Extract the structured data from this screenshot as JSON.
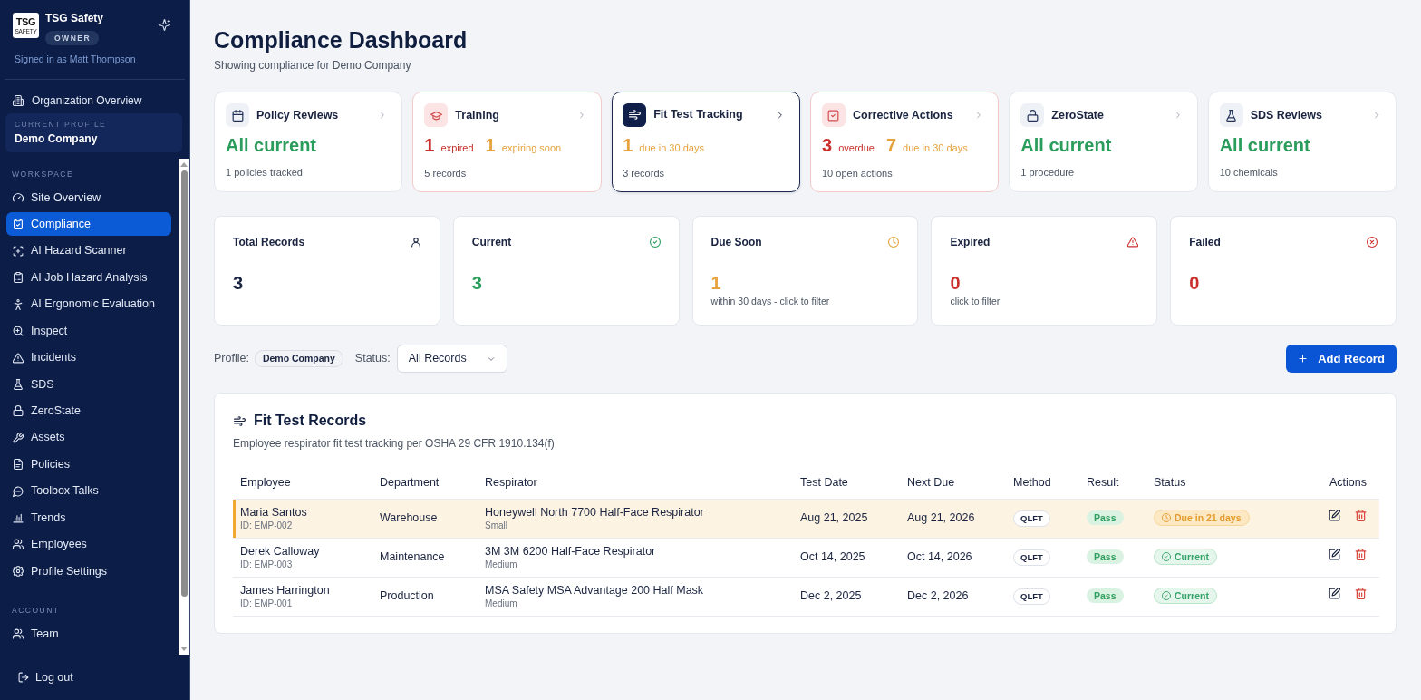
{
  "sidebar": {
    "brand": {
      "logo_text": "TSG",
      "logo_subtext": "SAFETY",
      "name": "TSG Safety",
      "role": "OWNER",
      "signed_in": "Signed in as Matt Thompson"
    },
    "overview_link": "Organization Overview",
    "current_profile": {
      "label": "CURRENT PROFILE",
      "name": "Demo Company"
    },
    "sections": [
      {
        "heading": "WORKSPACE",
        "items": [
          {
            "label": "Site Overview",
            "selected": false
          },
          {
            "label": "Compliance",
            "selected": true
          },
          {
            "label": "AI Hazard Scanner",
            "selected": false
          },
          {
            "label": "AI Job Hazard Analysis",
            "selected": false
          },
          {
            "label": "AI Ergonomic Evaluation",
            "selected": false
          },
          {
            "label": "Inspect",
            "selected": false
          },
          {
            "label": "Incidents",
            "selected": false
          },
          {
            "label": "SDS",
            "selected": false
          },
          {
            "label": "ZeroState",
            "selected": false
          },
          {
            "label": "Assets",
            "selected": false
          },
          {
            "label": "Policies",
            "selected": false
          },
          {
            "label": "Toolbox Talks",
            "selected": false
          },
          {
            "label": "Trends",
            "selected": false
          },
          {
            "label": "Employees",
            "selected": false
          },
          {
            "label": "Profile Settings",
            "selected": false
          }
        ]
      },
      {
        "heading": "ACCOUNT",
        "items": [
          {
            "label": "Team",
            "selected": false
          }
        ]
      }
    ],
    "logout": "Log out"
  },
  "header": {
    "title": "Compliance Dashboard",
    "subtitle": "Showing compliance for Demo Company"
  },
  "summary_cards": [
    {
      "title": "Policy Reviews",
      "selected": false,
      "alert": false,
      "kind": "summary",
      "headline": "All current",
      "footnote": "1 policies tracked"
    },
    {
      "title": "Training",
      "selected": false,
      "alert": true,
      "kind": "counts",
      "counts": [
        {
          "text": "**1** expired",
          "color": "#c9302c"
        },
        {
          "text": "**1** expiring soon",
          "color": "#e6a23c"
        }
      ],
      "footnote": "5 records"
    },
    {
      "title": "Fit Test Tracking",
      "selected": true,
      "alert": false,
      "kind": "counts",
      "counts": [
        {
          "text": "**1** due in 30 days",
          "color": "#e6a23c"
        }
      ],
      "footnote": "3 records"
    },
    {
      "title": "Corrective Actions",
      "selected": false,
      "alert": true,
      "kind": "counts",
      "counts": [
        {
          "text": "**3** overdue",
          "color": "#c9302c"
        },
        {
          "text": "**7** due in 30 days",
          "color": "#e6a23c"
        }
      ],
      "footnote": "10 open actions"
    },
    {
      "title": "ZeroState",
      "selected": false,
      "alert": false,
      "kind": "summary",
      "headline": "All current",
      "footnote": "1 procedure"
    },
    {
      "title": "SDS Reviews",
      "selected": false,
      "alert": false,
      "kind": "summary",
      "headline": "All current",
      "footnote": "10 chemicals"
    }
  ],
  "stats": [
    {
      "label": "Total Records",
      "value": "3",
      "color": "#1a2440"
    },
    {
      "label": "Current",
      "value": "3",
      "color": "#2a9d5c"
    },
    {
      "label": "Due Soon",
      "value": "1",
      "note": "within 30 days - click to filter",
      "color": "#e6a23c"
    },
    {
      "label": "Expired",
      "value": "0",
      "note": "click to filter",
      "color": "#c9302c"
    },
    {
      "label": "Failed",
      "value": "0",
      "color": "#c9302c"
    }
  ],
  "filters": {
    "profile_label": "Profile:",
    "profile": "Demo Company",
    "status_label": "Status:",
    "status_value": "All Records",
    "add_button": "Add Record"
  },
  "records": {
    "title": "Fit Test Records",
    "subtitle": "Employee respirator fit test tracking per OSHA 29 CFR 1910.134(f)",
    "columns": [
      "Employee",
      "Department",
      "Respirator",
      "Test Date",
      "Next Due",
      "Method",
      "Result",
      "Status",
      "Actions"
    ],
    "rows": [
      {
        "employee": "Maria Santos",
        "employee_id": "ID: EMP-002",
        "department": "Warehouse",
        "respirator": "Honeywell North 7700 Half-Face Respirator",
        "size": "Small",
        "test_date": "Aug 21, 2025",
        "next_due": "Aug 21, 2026",
        "method": "QLFT",
        "result": "Pass",
        "status": {
          "label": "Due in 21 days",
          "kind": "due_soon"
        },
        "flagged": true
      },
      {
        "employee": "Derek Calloway",
        "employee_id": "ID: EMP-003",
        "department": "Maintenance",
        "respirator": "3M 3M 6200 Half-Face Respirator",
        "size": "Medium",
        "test_date": "Oct 14, 2025",
        "next_due": "Oct 14, 2026",
        "method": "QLFT",
        "result": "Pass",
        "status": {
          "label": "Current",
          "kind": "current"
        },
        "flagged": false
      },
      {
        "employee": "James Harrington",
        "employee_id": "ID: EMP-001",
        "department": "Production",
        "respirator": "MSA Safety MSA Advantage 200 Half Mask",
        "size": "Medium",
        "test_date": "Dec 2, 2025",
        "next_due": "Dec 2, 2026",
        "method": "QLFT",
        "result": "Pass",
        "status": {
          "label": "Current",
          "kind": "current"
        },
        "flagged": false
      }
    ]
  }
}
